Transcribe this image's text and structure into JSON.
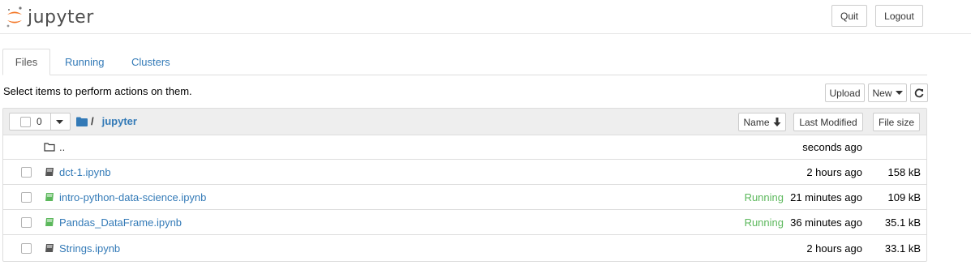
{
  "app": {
    "logo_text": "jupyter"
  },
  "header": {
    "quit_label": "Quit",
    "logout_label": "Logout"
  },
  "tabs": [
    {
      "label": "Files",
      "active": true
    },
    {
      "label": "Running",
      "active": false
    },
    {
      "label": "Clusters",
      "active": false
    }
  ],
  "toolbar": {
    "message": "Select items to perform actions on them.",
    "upload_label": "Upload",
    "new_label": "New",
    "refresh_icon": "refresh-icon"
  },
  "listing_header": {
    "selected_count": "0",
    "breadcrumb_separator": "/",
    "breadcrumb_folder": "jupyter",
    "sort_name_label": "Name",
    "last_modified_label": "Last Modified",
    "file_size_label": "File size"
  },
  "rows": [
    {
      "name": "..",
      "type": "folder",
      "running": "",
      "modified": "seconds ago",
      "size": ""
    },
    {
      "name": "dct-1.ipynb",
      "type": "notebook",
      "running": "",
      "modified": "2 hours ago",
      "size": "158 kB"
    },
    {
      "name": "intro-python-data-science.ipynb",
      "type": "notebook-running",
      "running": "Running",
      "modified": "21 minutes ago",
      "size": "109 kB"
    },
    {
      "name": "Pandas_DataFrame.ipynb",
      "type": "notebook-running",
      "running": "Running",
      "modified": "36 minutes ago",
      "size": "35.1 kB"
    },
    {
      "name": "Strings.ipynb",
      "type": "notebook",
      "running": "",
      "modified": "2 hours ago",
      "size": "33.1 kB"
    }
  ],
  "colors": {
    "link": "#337ab7",
    "running": "#5cb85c",
    "logo_orange": "#f37726"
  }
}
